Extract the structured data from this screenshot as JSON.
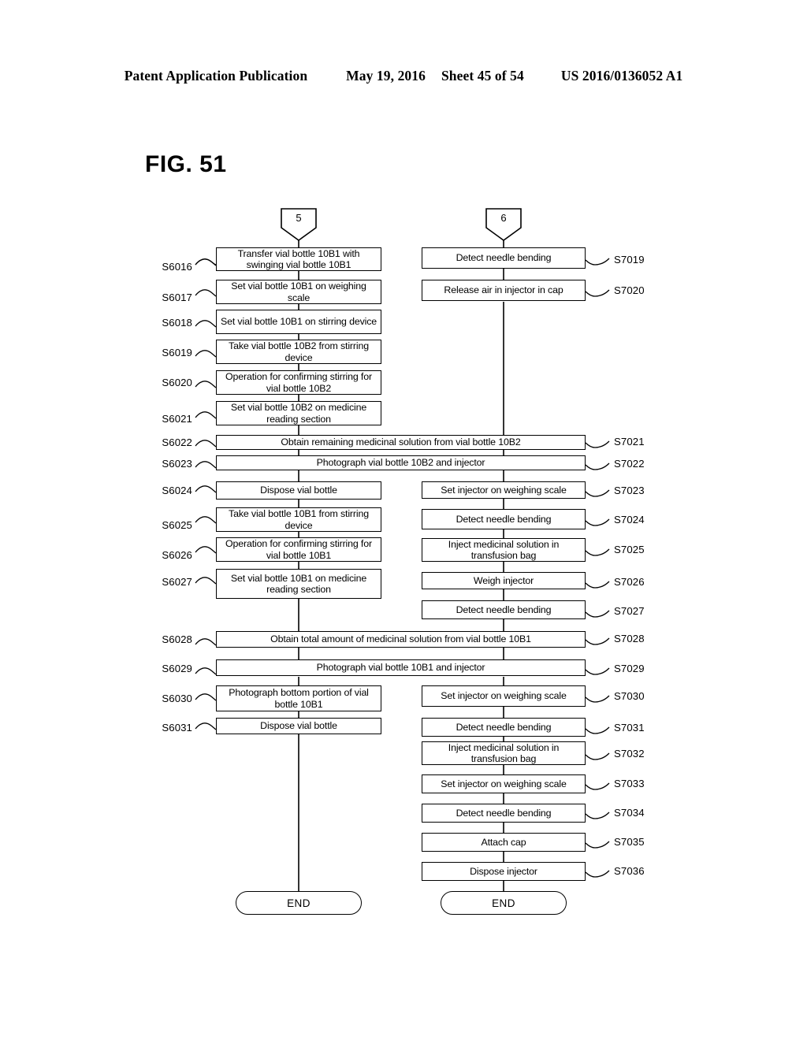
{
  "header": {
    "publication": "Patent Application Publication",
    "date": "May 19, 2016",
    "sheet": "Sheet 45 of 54",
    "patent_number": "US 2016/0136052 A1"
  },
  "figure": {
    "title": "FIG. 51"
  },
  "connectors": [
    {
      "id": "conn-5",
      "label": "5",
      "column": "left"
    },
    {
      "id": "conn-6",
      "label": "6",
      "column": "right"
    }
  ],
  "left_column": {
    "steps": [
      {
        "ref": "S6016",
        "text": "Transfer vial bottle 10B1 with swinging vial bottle 10B1"
      },
      {
        "ref": "S6017",
        "text": "Set vial bottle 10B1 on weighing scale"
      },
      {
        "ref": "S6018",
        "text": "Set vial bottle 10B1 on stirring device"
      },
      {
        "ref": "S6019",
        "text": "Take vial bottle 10B2 from stirring device"
      },
      {
        "ref": "S6020",
        "text": "Operation for confirming stirring for vial bottle 10B2"
      },
      {
        "ref": "S6021",
        "text": "Set vial bottle 10B2 on medicine reading section"
      },
      {
        "ref": "S6024",
        "text": "Dispose vial bottle"
      },
      {
        "ref": "S6025",
        "text": "Take vial bottle 10B1 from stirring device"
      },
      {
        "ref": "S6026",
        "text": "Operation for confirming stirring for vial bottle 10B1"
      },
      {
        "ref": "S6027",
        "text": "Set vial bottle 10B1 on medicine reading section"
      },
      {
        "ref": "S6030",
        "text": "Photograph bottom portion of vial bottle 10B1"
      },
      {
        "ref": "S6031",
        "text": "Dispose vial bottle"
      }
    ],
    "terminator": "END"
  },
  "wide_steps": [
    {
      "ref_left": "S6022",
      "ref_right": "S7021",
      "text": "Obtain remaining medicinal solution from vial bottle 10B2"
    },
    {
      "ref_left": "S6023",
      "ref_right": "S7022",
      "text": "Photograph vial bottle 10B2 and injector"
    },
    {
      "ref_left": "S6028",
      "ref_right": "S7028",
      "text": "Obtain total amount of medicinal solution from vial bottle 10B1"
    },
    {
      "ref_left": "S6029",
      "ref_right": "S7029",
      "text": "Photograph vial bottle 10B1 and injector"
    }
  ],
  "right_column": {
    "steps": [
      {
        "ref": "S7019",
        "text": "Detect needle bending"
      },
      {
        "ref": "S7020",
        "text": "Release air in injector in cap"
      },
      {
        "ref": "S7023",
        "text": "Set injector on weighing scale"
      },
      {
        "ref": "S7024",
        "text": "Detect needle bending"
      },
      {
        "ref": "S7025",
        "text": "Inject medicinal solution in transfusion bag"
      },
      {
        "ref": "S7026",
        "text": "Weigh injector"
      },
      {
        "ref": "S7027",
        "text": "Detect needle bending"
      },
      {
        "ref": "S7030",
        "text": "Set injector on weighing scale"
      },
      {
        "ref": "S7031",
        "text": "Detect needle bending"
      },
      {
        "ref": "S7032",
        "text": "Inject medicinal solution in transfusion bag"
      },
      {
        "ref": "S7033",
        "text": "Set injector on weighing scale"
      },
      {
        "ref": "S7034",
        "text": "Detect needle bending"
      },
      {
        "ref": "S7035",
        "text": "Attach cap"
      },
      {
        "ref": "S7036",
        "text": "Dispose injector"
      }
    ],
    "terminator": "END"
  },
  "colors": {
    "stroke": "#000000",
    "fill": "#ffffff",
    "text": "#000000"
  }
}
